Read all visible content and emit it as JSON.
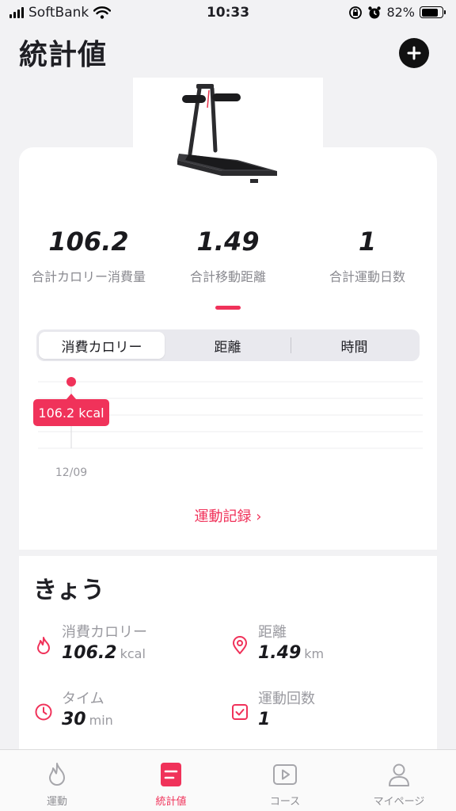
{
  "status_bar": {
    "carrier": "SoftBank",
    "time": "10:33",
    "battery": "82%",
    "battery_level": 0.82
  },
  "header": {
    "title": "統計値"
  },
  "totals": [
    {
      "value": "106.2",
      "label": "合計カロリー消費量"
    },
    {
      "value": "1.49",
      "label": "合計移動距離"
    },
    {
      "value": "1",
      "label": "合計運動日数"
    }
  ],
  "segments": [
    {
      "label": "消費カロリー",
      "active": true
    },
    {
      "label": "距離",
      "active": false
    },
    {
      "label": "時間",
      "active": false
    }
  ],
  "chart_data": {
    "type": "scatter",
    "x": [
      "12/09"
    ],
    "y": [
      106.2
    ],
    "point_label": "106.2 kcal",
    "grid": true
  },
  "history_link": "運動記録 ›",
  "today": {
    "title": "きょう",
    "calories": {
      "label": "消費カロリー",
      "value": "106.2",
      "unit": "kcal"
    },
    "distance": {
      "label": "距離",
      "value": "1.49",
      "unit": "km"
    },
    "time": {
      "label": "タイム",
      "value": "30",
      "unit": "min"
    },
    "count": {
      "label": "運動回数",
      "value": "1",
      "unit": ""
    }
  },
  "tabs": [
    {
      "label": "運動",
      "icon": "flame-icon",
      "active": false
    },
    {
      "label": "統計値",
      "icon": "stats-icon",
      "active": true
    },
    {
      "label": "コース",
      "icon": "play-icon",
      "active": false
    },
    {
      "label": "マイページ",
      "icon": "person-icon",
      "active": false
    }
  ],
  "colors": {
    "accent": "#f0325a",
    "background": "#f2f2f4"
  }
}
